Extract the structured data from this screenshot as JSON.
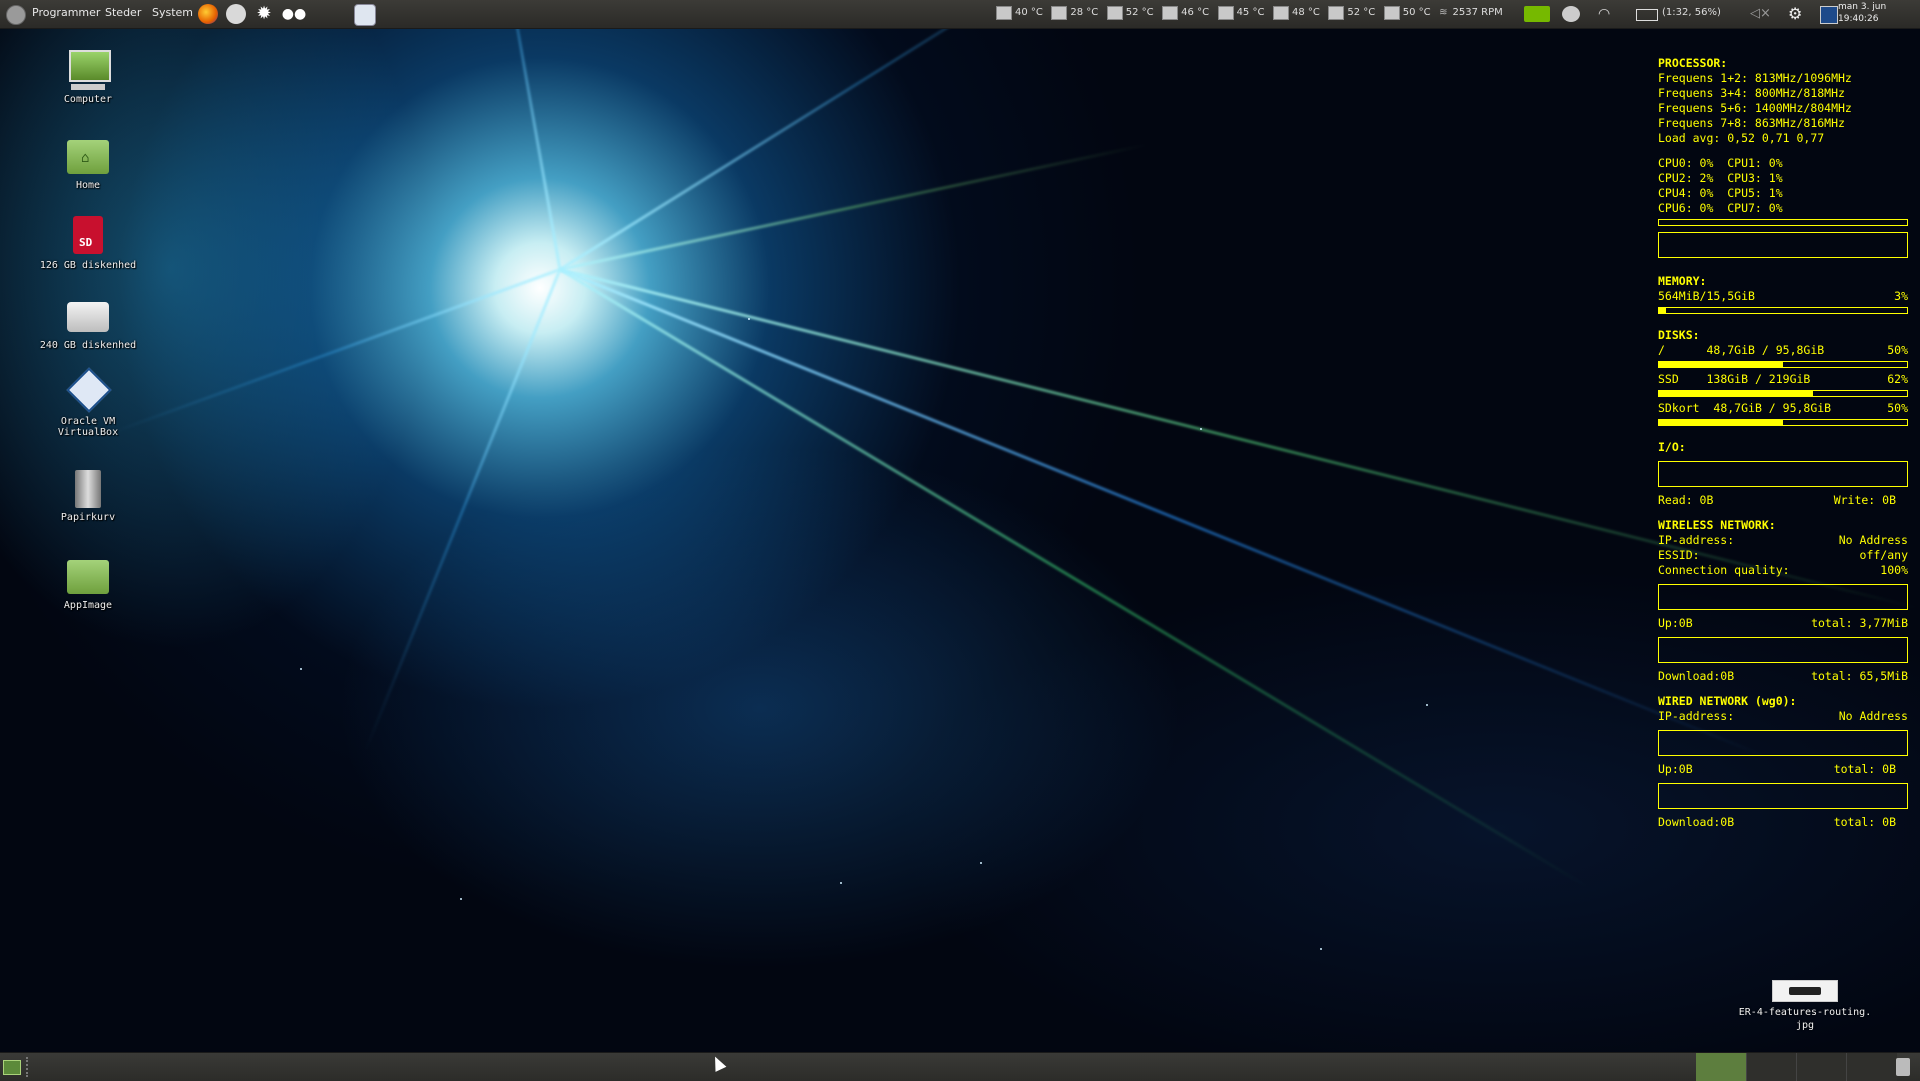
{
  "top_panel": {
    "menus": [
      "Programmer",
      "Steder",
      "System"
    ],
    "sensors": [
      {
        "value": "40 °C"
      },
      {
        "value": "28 °C"
      },
      {
        "value": "52 °C"
      },
      {
        "value": "46 °C"
      },
      {
        "value": "45 °C"
      },
      {
        "value": "48 °C"
      },
      {
        "value": "52 °C"
      },
      {
        "value": "50 °C"
      }
    ],
    "fan": "2537 RPM",
    "battery": "(1:32, 56%)",
    "clock": {
      "line1": "man  3. jun",
      "line2": "19:40:26"
    }
  },
  "desktop_icons": [
    {
      "label": "Computer",
      "icon": "computer-icon"
    },
    {
      "label": "Home",
      "icon": "home-folder-icon"
    },
    {
      "label": "126 GB diskenhed",
      "icon": "sd-card-icon"
    },
    {
      "label": "240 GB diskenhed",
      "icon": "drive-icon"
    },
    {
      "label": "Oracle VM VirtualBox",
      "icon": "virtualbox-icon"
    },
    {
      "label": "Papirkurv",
      "icon": "trash-icon"
    },
    {
      "label": "AppImage",
      "icon": "folder-icon"
    }
  ],
  "conky": {
    "processor": {
      "title": "PROCESSOR:",
      "freq": [
        "Frequens 1+2: 813MHz/1096MHz",
        "Frequens 3+4: 800MHz/818MHz",
        "Frequens 5+6: 1400MHz/804MHz",
        "Frequens 7+8: 863MHz/816MHz"
      ],
      "load": "Load avg: 0,52 0,71 0,77",
      "cpus": [
        "CPU0: 0%  CPU1: 0%",
        "CPU2: 2%  CPU3: 1%",
        "CPU4: 0%  CPU5: 1%",
        "CPU6: 0%  CPU7: 0%"
      ]
    },
    "memory": {
      "title": "MEMORY:",
      "value": "564MiB/15,5GiB",
      "percent": "3%",
      "fill": 0.03
    },
    "disks": {
      "title": "DISKS:",
      "items": [
        {
          "name": "/",
          "usage": "48,7GiB / 95,8GiB",
          "percent": "50%",
          "fill": 0.5
        },
        {
          "name": "SSD",
          "usage": "138GiB / 219GiB",
          "percent": "62%",
          "fill": 0.62
        },
        {
          "name": "SDkort",
          "usage": "48,7GiB / 95,8GiB",
          "percent": "50%",
          "fill": 0.5
        }
      ]
    },
    "io": {
      "title": "I/O:",
      "read": "Read: 0B",
      "write": "Write: 0B"
    },
    "wireless": {
      "title": "WIRELESS NETWORK:",
      "ip_label": "IP-address:",
      "ip_value": "No Address",
      "essid_label": "ESSID:",
      "essid_value": "off/any",
      "quality_label": "Connection quality:",
      "quality_value": "100%",
      "up": "Up:0B",
      "up_total": "total: 3,77MiB",
      "down": "Download:0B",
      "down_total": "total: 65,5MiB"
    },
    "wired": {
      "title": "WIRED NETWORK (wg0):",
      "ip_label": "IP-address:",
      "ip_value": "No Address",
      "up": "Up:0B",
      "up_total": "total: 0B",
      "down": "Download:0B",
      "down_total": "total: 0B"
    }
  },
  "desktop_file": {
    "line1": "ER-4-features-routing.",
    "line2": "jpg"
  },
  "colors": {
    "conky": "#ffff00",
    "panel": "#3c3b37"
  }
}
